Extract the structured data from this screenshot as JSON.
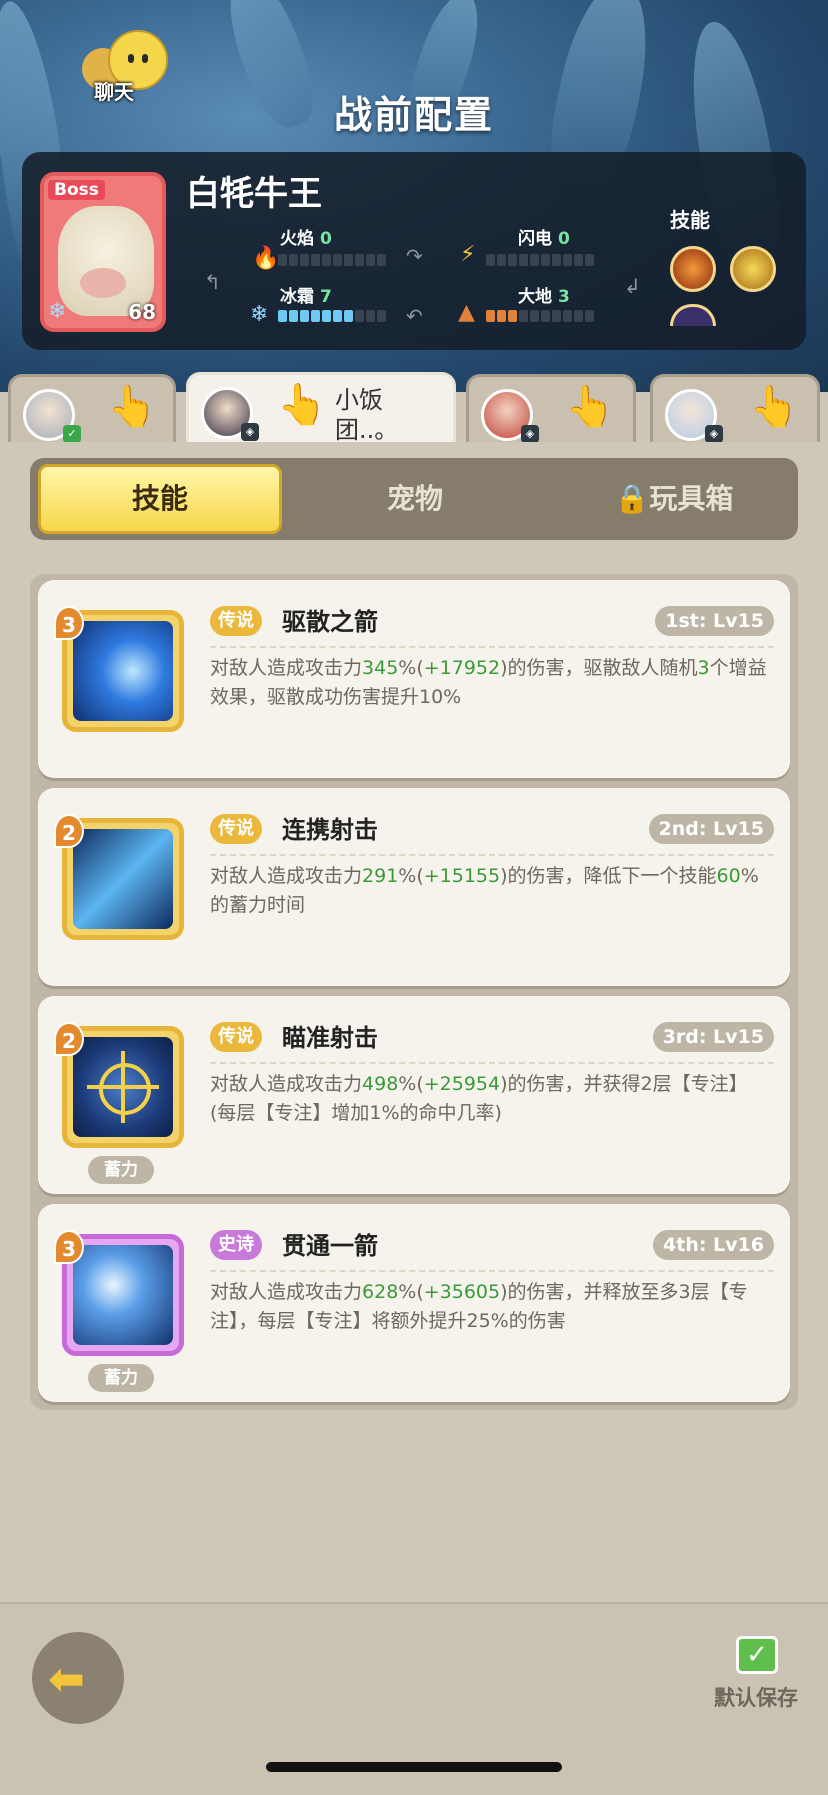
{
  "chat": {
    "label": "聊天"
  },
  "title": "战前配置",
  "boss": {
    "tag": "Boss",
    "name": "白牦牛王",
    "level": "68",
    "stats": [
      {
        "label": "火焰",
        "value": "0",
        "level": 0,
        "icon": "fire-icon"
      },
      {
        "label": "闪电",
        "value": "0",
        "level": 0,
        "icon": "lightning-icon"
      },
      {
        "label": "冰霜",
        "value": "7",
        "level": 7,
        "icon": "snowflake-icon"
      },
      {
        "label": "大地",
        "value": "3",
        "level": 3,
        "icon": "earth-icon"
      }
    ],
    "skills_label": "技能"
  },
  "heroes": [
    {
      "name": "",
      "active": false
    },
    {
      "name": "小饭团..。",
      "active": true
    },
    {
      "name": "",
      "active": false
    },
    {
      "name": "",
      "active": false
    }
  ],
  "tabs": {
    "skill": "技能",
    "pet": "宠物",
    "toy": "玩具箱"
  },
  "skills": [
    {
      "level": "3",
      "rarity": "传说",
      "name": "驱散之箭",
      "rank": "1st: Lv15",
      "charge": "",
      "desc": [
        [
          "对敌人造成攻击力",
          0
        ],
        [
          "345",
          1
        ],
        [
          "%(",
          0
        ],
        [
          "+17952",
          1
        ],
        [
          ")的伤害，驱散敌人随机",
          0
        ],
        [
          "3",
          1
        ],
        [
          "个增益效果，驱散成功伤害提升10%",
          0
        ]
      ]
    },
    {
      "level": "2",
      "rarity": "传说",
      "name": "连携射击",
      "rank": "2nd: Lv15",
      "charge": "",
      "desc": [
        [
          "对敌人造成攻击力",
          0
        ],
        [
          "291",
          1
        ],
        [
          "%(",
          0
        ],
        [
          "+15155",
          1
        ],
        [
          ")的伤害，降低下一个技能",
          0
        ],
        [
          "60",
          1
        ],
        [
          "%的蓄力时间",
          0
        ]
      ]
    },
    {
      "level": "2",
      "rarity": "传说",
      "name": "瞄准射击",
      "rank": "3rd: Lv15",
      "charge": "蓄力",
      "desc": [
        [
          "对敌人造成攻击力",
          0
        ],
        [
          "498",
          1
        ],
        [
          "%(",
          0
        ],
        [
          "+25954",
          1
        ],
        [
          ")的伤害，并获得2层【专注】(每层【专注】增加1%的命中几率)",
          0
        ]
      ]
    },
    {
      "level": "3",
      "rarity": "史诗",
      "name": "贯通一箭",
      "rank": "4th: Lv16",
      "charge": "蓄力",
      "desc": [
        [
          "对敌人造成攻击力",
          0
        ],
        [
          "628",
          1
        ],
        [
          "%(",
          0
        ],
        [
          "+35605",
          1
        ],
        [
          ")的伤害，并释放至多3层【专注】，每层【专注】将额外提升25%的伤害",
          0
        ]
      ]
    }
  ],
  "bottom": {
    "save_label": "默认保存"
  },
  "colors": {
    "highlight": "#3a9a3a",
    "legend": "#eab83a",
    "epic": "#c77ad8",
    "tab_active": "#f6d64a"
  }
}
